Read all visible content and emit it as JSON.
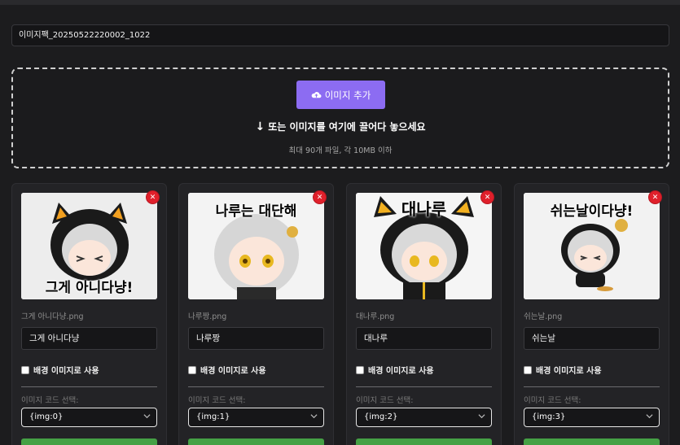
{
  "pack_name": "이미지팩_20250522220002_1022",
  "dropzone": {
    "add_button_label": "이미지 추가",
    "hint": "또는 이미지를 여기에 끌어다 놓으세요",
    "limit": "최대 90개 파일, 각 10MB 이하"
  },
  "cards": [
    {
      "filename": "그게 아니다냥.png",
      "label_value": "그게 아니다냥",
      "image_caption": "그게 아니다냥!",
      "bg_checkbox_label": "배경 이미지로 사용",
      "code_label": "이미지 코드 선택:",
      "code_value": "{img:0}"
    },
    {
      "filename": "나루짱.png",
      "label_value": "나루짱",
      "image_caption": "나루는 대단해",
      "bg_checkbox_label": "배경 이미지로 사용",
      "code_label": "이미지 코드 선택:",
      "code_value": "{img:1}"
    },
    {
      "filename": "대나루.png",
      "label_value": "대나루",
      "image_caption": "대나루",
      "bg_checkbox_label": "배경 이미지로 사용",
      "code_label": "이미지 코드 선택:",
      "code_value": "{img:2}"
    },
    {
      "filename": "쉬는날.png",
      "label_value": "쉬는날",
      "image_caption": "쉬는날이다냥!",
      "bg_checkbox_label": "배경 이미지로 사용",
      "code_label": "이미지 코드 선택:",
      "code_value": "{img:3}"
    }
  ],
  "colors": {
    "accent": "#8c6cf2",
    "remove": "#e0202b",
    "apply": "#45a145",
    "background": "#1c1c1e"
  },
  "icons": {
    "upload": "cloud-upload-icon",
    "arrow": "arrow-down-icon",
    "remove": "close-icon",
    "select": "chevron-down-icon"
  }
}
